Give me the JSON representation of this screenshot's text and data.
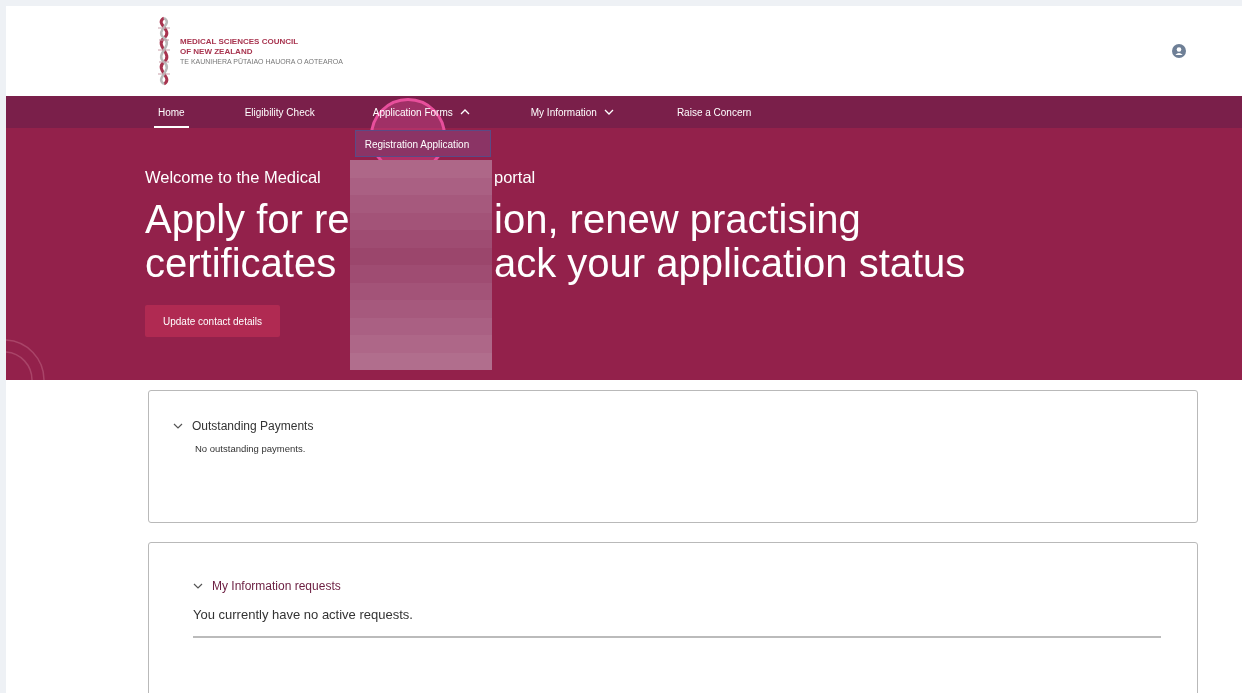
{
  "header": {
    "logo": {
      "name_line_1": "MEDICAL SCIENCES COUNCIL",
      "name_line_2": "OF NEW ZEALAND",
      "tagline": "TE KAUNIHERA PŪTAIAO HAUORA O AOTEAROA"
    }
  },
  "nav": [
    {
      "label": "Home",
      "selected": true,
      "kind": "link"
    },
    {
      "label": "Eligibility Check",
      "selected": false,
      "kind": "link"
    },
    {
      "label": "Application Forms",
      "selected": false,
      "kind": "menu",
      "expanded": true,
      "menu": [
        "Registration Application"
      ]
    },
    {
      "label": "My Information",
      "selected": false,
      "kind": "menu",
      "expanded": false
    },
    {
      "label": "Raise a Concern",
      "selected": false,
      "kind": "link"
    }
  ],
  "hero": {
    "lines": [
      {
        "kind": "intro",
        "before": "Welcome to the Medical",
        "after": "portal"
      },
      {
        "kind": "heading",
        "before": "Apply for re",
        "after": "ion, renew practising"
      },
      {
        "kind": "heading",
        "before": "certificates",
        "after": "ack your application status"
      }
    ],
    "button": "Update contact details"
  },
  "sections": [
    {
      "title": "Outstanding Payments",
      "expanded": true,
      "kind": "payments",
      "message": "No outstanding payments."
    },
    {
      "title": "My Information requests",
      "expanded": true,
      "kind": "requests",
      "message": "You currently have no active requests."
    }
  ]
}
